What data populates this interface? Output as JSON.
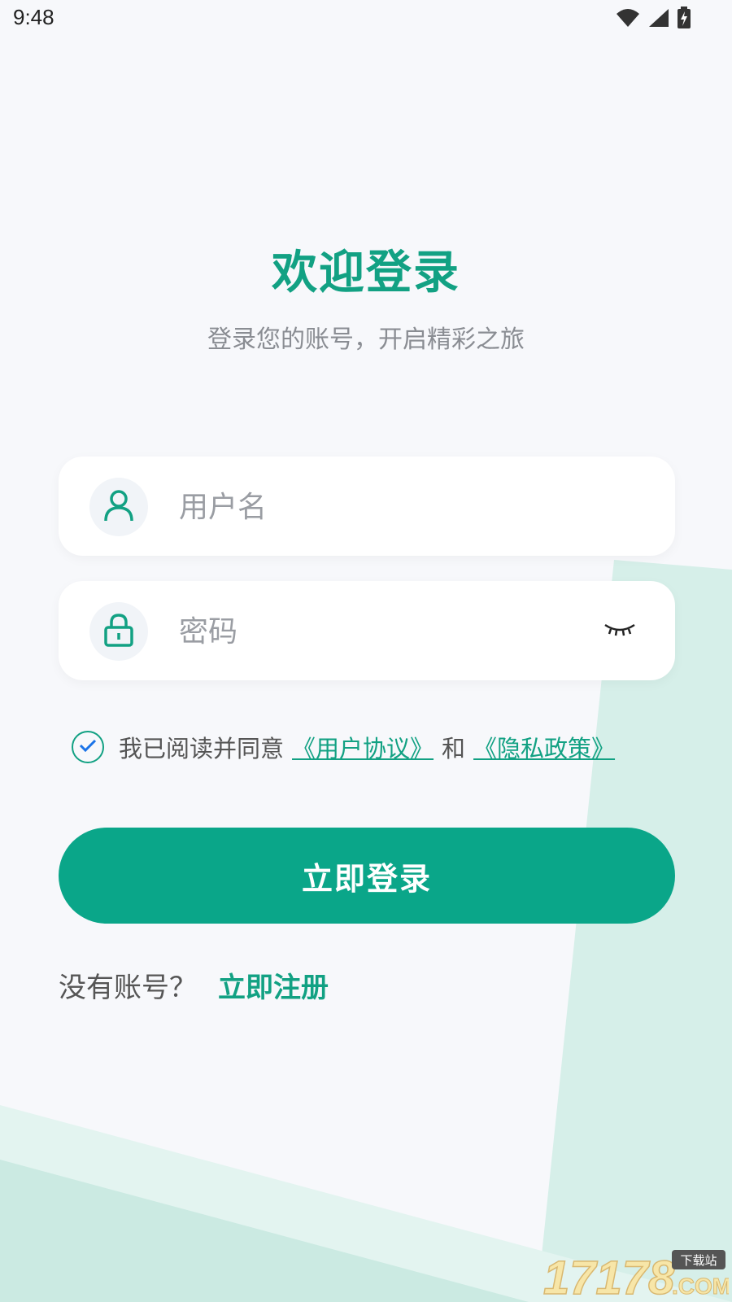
{
  "status_bar": {
    "time": "9:48"
  },
  "login": {
    "title": "欢迎登录",
    "subtitle": "登录您的账号，开启精彩之旅",
    "username_placeholder": "用户名",
    "password_placeholder": "密码",
    "agree_text": "我已阅读并同意",
    "user_agreement": "《用户协议》",
    "and": "和",
    "privacy_policy": "《隐私政策》",
    "agree_checked": true,
    "login_button": "立即登录",
    "no_account": "没有账号？",
    "register": "立即注册"
  },
  "watermark": {
    "text": "17178.COM",
    "badge": "下载站"
  },
  "colors": {
    "accent": "#12a183",
    "button": "#0aa689",
    "background": "#f7f8fb",
    "decor": "#d4eee8"
  },
  "icons": [
    "wifi-icon",
    "signal-icon",
    "battery-icon",
    "user-icon",
    "lock-icon",
    "eye-closed-icon",
    "check-icon"
  ]
}
